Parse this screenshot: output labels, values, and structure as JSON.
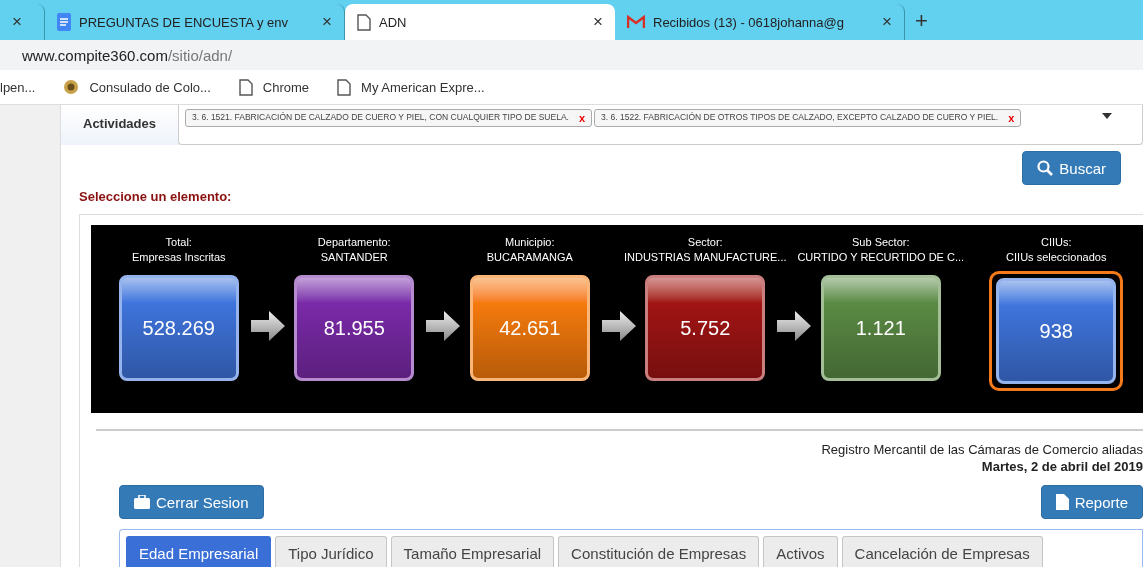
{
  "browser": {
    "tabs": [
      {
        "kind": "partial",
        "selected": false
      },
      {
        "title": "PREGUNTAS DE ENCUESTA y env",
        "kind": "docs",
        "selected": false
      },
      {
        "title": "ADN",
        "kind": "page",
        "selected": true
      },
      {
        "title": "Recibidos (13) - 0618johanna@g",
        "kind": "mail",
        "selected": false
      }
    ],
    "new_tab": "+",
    "close": "×",
    "address": {
      "host": "www.compite360.com",
      "path": "/sitio/adn/"
    },
    "bookmarks": [
      {
        "label": "lpen...",
        "kind": "none"
      },
      {
        "label": "Consulado de Colo...",
        "kind": "seal"
      },
      {
        "label": "Chrome",
        "kind": "page"
      },
      {
        "label": "My American Expre...",
        "kind": "page"
      }
    ]
  },
  "filter": {
    "label": "Actividades",
    "tags": [
      {
        "text": "3. 6. 1521. FABRICACIÓN DE CALZADO DE CUERO Y PIEL, CON CUALQUIER TIPO DE SUELA.",
        "remove": "x"
      },
      {
        "text": "3. 6. 1522. FABRICACIÓN DE OTROS TIPOS DE CALZADO, EXCEPTO CALZADO DE CUERO Y PIEL.",
        "remove": "x"
      }
    ],
    "search_button": "Buscar"
  },
  "prompt": "Seleccione un elemento:",
  "cards": [
    {
      "title": "Total:",
      "subtitle": "Empresas Inscritas",
      "value": "528.269",
      "color": "#3f74dc",
      "selected": false
    },
    {
      "title": "Departamento:",
      "subtitle": "SANTANDER",
      "value": "81.955",
      "color": "#7a2aa8",
      "selected": false
    },
    {
      "title": "Municipio:",
      "subtitle": "BUCARAMANGA",
      "value": "42.651",
      "color": "#f57a0c",
      "selected": false
    },
    {
      "title": "Sector:",
      "subtitle": "INDUSTRIAS MANUFACTURE...",
      "value": "5.752",
      "color": "#a01414",
      "selected": false
    },
    {
      "title": "Sub Sector:",
      "subtitle": "CURTIDO Y RECURTIDO DE C...",
      "value": "1.121",
      "color": "#5a8a44",
      "selected": false
    },
    {
      "title": "CIIUs:",
      "subtitle": "CIIUs seleccionados",
      "value": "938",
      "color": "#3f74dc",
      "selected": true
    }
  ],
  "source": "Registro Mercantil de las Cámaras de Comercio aliadas",
  "date": "Martes, 2 de abril del 2019",
  "logout_button": "Cerrar Sesion",
  "report_button": "Reporte",
  "section_tabs": [
    {
      "label": "Edad Empresarial",
      "selected": true
    },
    {
      "label": "Tipo Jurídico",
      "selected": false
    },
    {
      "label": "Tamaño Empresarial",
      "selected": false
    },
    {
      "label": "Constitución de Empresas",
      "selected": false
    },
    {
      "label": "Activos",
      "selected": false
    },
    {
      "label": "Cancelación de Empresas",
      "selected": false
    }
  ]
}
